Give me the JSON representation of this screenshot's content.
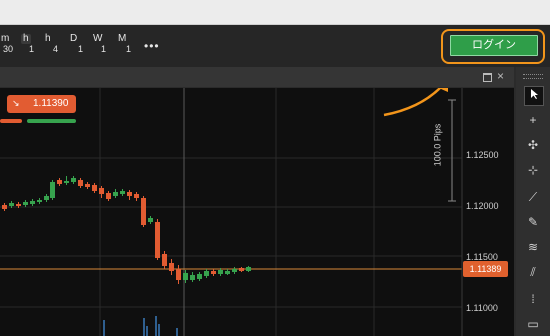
{
  "timeframes": [
    {
      "unit": "m",
      "num": "30"
    },
    {
      "unit": "h",
      "num": "1"
    },
    {
      "unit": "h",
      "num": "4"
    },
    {
      "unit": "D",
      "num": "1"
    },
    {
      "unit": "W",
      "num": "1"
    },
    {
      "unit": "M",
      "num": "1"
    }
  ],
  "more_label": "•••",
  "login_label": "ログイン",
  "ticker": {
    "arrow": "↘",
    "price": "1.11390"
  },
  "y_labels": [
    "1.12500",
    "1.12000",
    "1.11500",
    "1.11000"
  ],
  "price_tag": "1.11389",
  "pips_label": "100.0 Pips",
  "close_glyph": "×",
  "colors": {
    "up": "#37a34e",
    "down": "#e25c32",
    "accent": "#f2951b",
    "price_line": "#d88a3a"
  },
  "tools": [
    "cursor-icon",
    "crosshair-icon",
    "move-icon",
    "measure-icon",
    "trendline-icon",
    "brush-icon",
    "fib-icon",
    "pitchfork-icon",
    "grid-icon",
    "rectangle-icon"
  ]
}
